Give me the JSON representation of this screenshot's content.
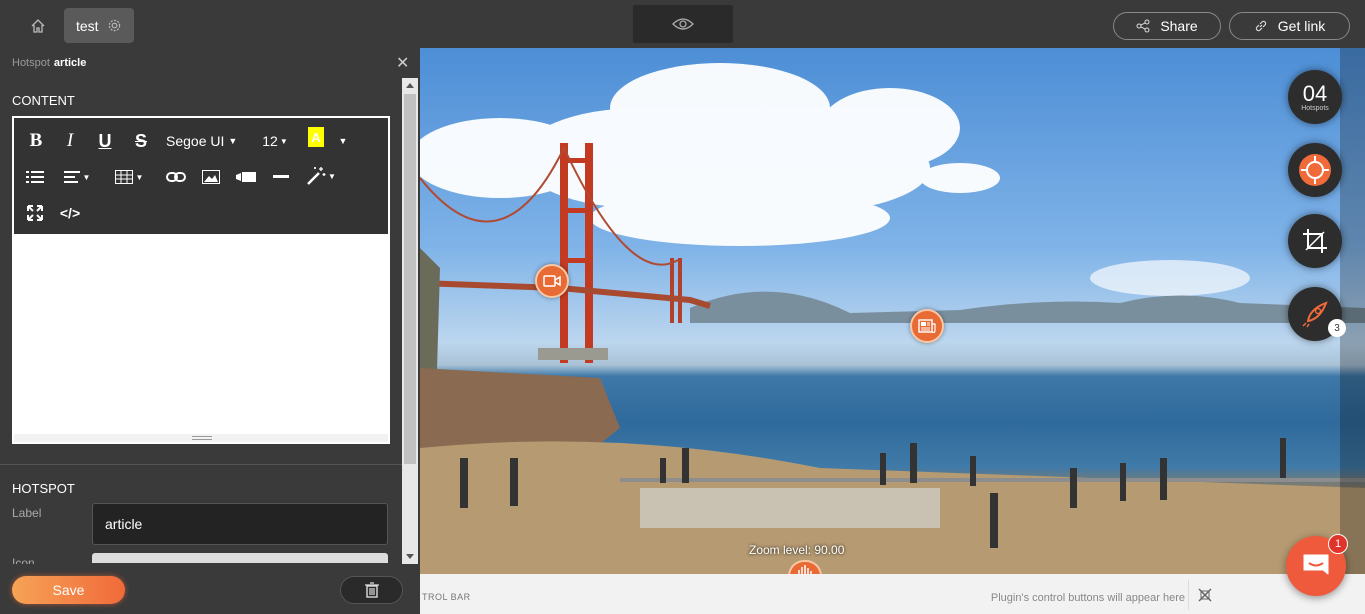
{
  "topbar": {
    "tab_label": "test",
    "share_label": "Share",
    "getlink_label": "Get link"
  },
  "panel": {
    "crumb_prefix": "Hotspot",
    "crumb_name": "article",
    "content_title": "CONTENT",
    "toolbar": {
      "bold": "B",
      "italic": "I",
      "underline": "U",
      "strike": "S",
      "font": "Segoe UI",
      "size": "12",
      "highlight": "A",
      "code": "</>"
    },
    "hotspot_title": "HOTSPOT",
    "label_label": "Label",
    "label_value": "article",
    "icon_label": "Icon"
  },
  "footer": {
    "save_label": "Save"
  },
  "viewer": {
    "hotspot_count": "04",
    "hotspot_count_label": "Hotspots",
    "rocket_badge": "3",
    "zoom_text": "Zoom level: 90.00",
    "ctrl_label": "TROL BAR",
    "ctrl_msg": "Plugin's control buttons will appear here",
    "chat_badge": "1"
  },
  "colors": {
    "accent": "#f06a3a",
    "hotspot": "#e86a34",
    "dark": "#3a3a3a"
  }
}
